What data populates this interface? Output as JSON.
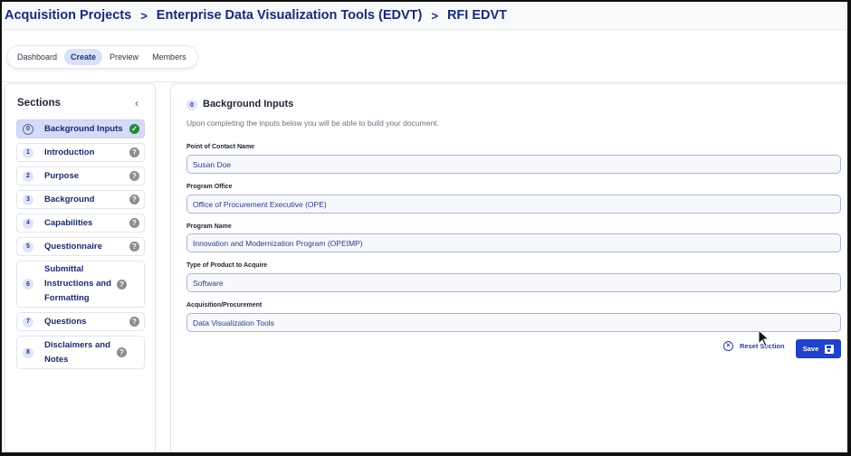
{
  "breadcrumb": {
    "items": [
      "Acquisition Projects",
      "Enterprise Data Visualization Tools (EDVT)",
      "RFI EDVT"
    ],
    "separator": ">"
  },
  "tabs": [
    {
      "label": "Dashboard",
      "active": false
    },
    {
      "label": "Create",
      "active": true
    },
    {
      "label": "Preview",
      "active": false
    },
    {
      "label": "Members",
      "active": false
    }
  ],
  "sidebar": {
    "title": "Sections",
    "collapse_icon": "chevron-left-icon",
    "collapse_glyph": "‹",
    "sections": [
      {
        "number": "0",
        "label": "Background Inputs",
        "status": "complete",
        "status_glyph": "✓"
      },
      {
        "number": "1",
        "label": "Introduction",
        "status": "help",
        "status_glyph": "?"
      },
      {
        "number": "2",
        "label": "Purpose",
        "status": "help",
        "status_glyph": "?"
      },
      {
        "number": "3",
        "label": "Background",
        "status": "help",
        "status_glyph": "?"
      },
      {
        "number": "4",
        "label": "Capabilities",
        "status": "help",
        "status_glyph": "?"
      },
      {
        "number": "5",
        "label": "Questionnaire",
        "status": "help",
        "status_glyph": "?"
      },
      {
        "number": "6",
        "label": "Submittal Instructions and Formatting",
        "status": "help",
        "status_glyph": "?"
      },
      {
        "number": "7",
        "label": "Questions",
        "status": "help",
        "status_glyph": "?"
      },
      {
        "number": "8",
        "label": "Disclaimers and Notes",
        "status": "help",
        "status_glyph": "?"
      }
    ]
  },
  "main": {
    "section_number": "0",
    "title": "Background Inputs",
    "description": "Upon completing the inputs below you will be able to build your document.",
    "fields": [
      {
        "label": "Point of Contact Name",
        "value": "Susan Doe"
      },
      {
        "label": "Program Office",
        "value": "Office of Procurement Executive (OPE)"
      },
      {
        "label": "Program Name",
        "value": "Innovation and Modernization Program (OPEIMP)"
      },
      {
        "label": "Type of Product to Acquire",
        "value": "Software"
      },
      {
        "label": "Acquisition/Procurement",
        "value": "Data Visualization Tools"
      }
    ],
    "reset_label": "Reset Section",
    "reset_glyph": "×",
    "save_label": "Save"
  },
  "colors": {
    "brand_navy": "#1a2a78",
    "primary_button": "#2141c8",
    "active_highlight": "#d3dbf6",
    "complete_green": "#1e8a3a",
    "help_gray": "#8d8d8d"
  }
}
